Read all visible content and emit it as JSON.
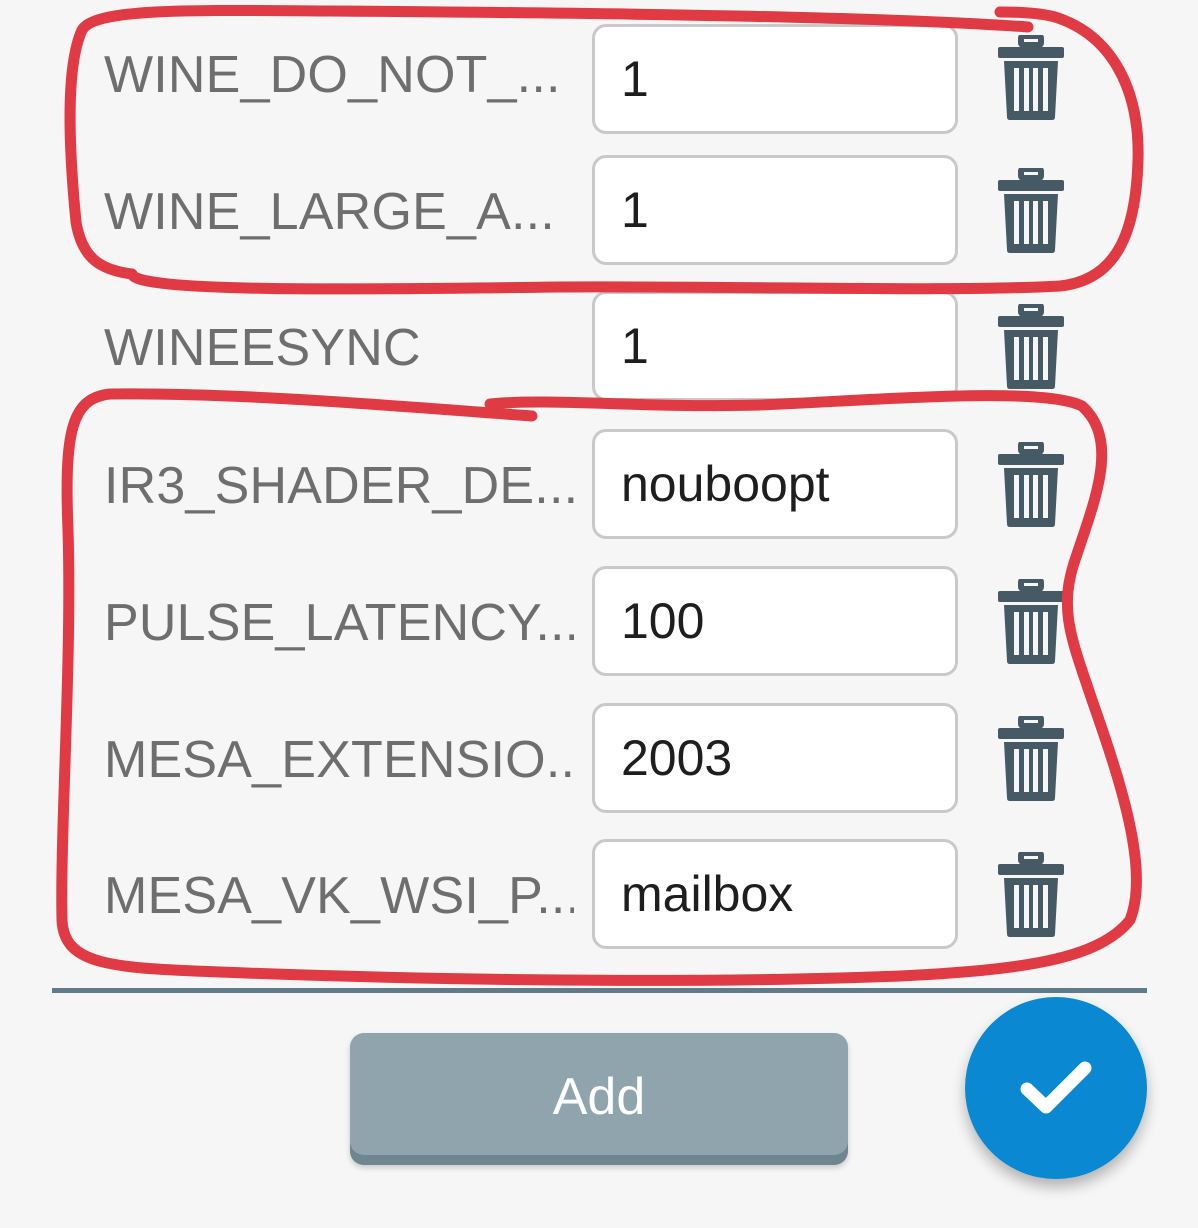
{
  "env_vars": [
    {
      "name": "WINE_DO_NOT_...",
      "value": "1",
      "delete_icon": "trash-icon"
    },
    {
      "name": "WINE_LARGE_A...",
      "value": "1",
      "delete_icon": "trash-icon"
    },
    {
      "name": "WINEESYNC",
      "value": "1",
      "delete_icon": "trash-icon"
    },
    {
      "name": "IR3_SHADER_DE...",
      "value": "nouboopt",
      "delete_icon": "trash-icon"
    },
    {
      "name": "PULSE_LATENCY...",
      "value": "100",
      "delete_icon": "trash-icon"
    },
    {
      "name": "MESA_EXTENSIO...",
      "value": "2003",
      "delete_icon": "trash-icon"
    },
    {
      "name": "MESA_VK_WSI_P...",
      "value": "mailbox",
      "delete_icon": "trash-icon"
    }
  ],
  "footer": {
    "add_label": "Add",
    "confirm_icon": "checkmark-icon"
  },
  "colors": {
    "annotation_stroke": "#e03a45",
    "fab_background": "#0a88d1",
    "add_button_background": "#90a4ae",
    "trash_icon": "#455a64",
    "divider": "#5d7b8a"
  }
}
